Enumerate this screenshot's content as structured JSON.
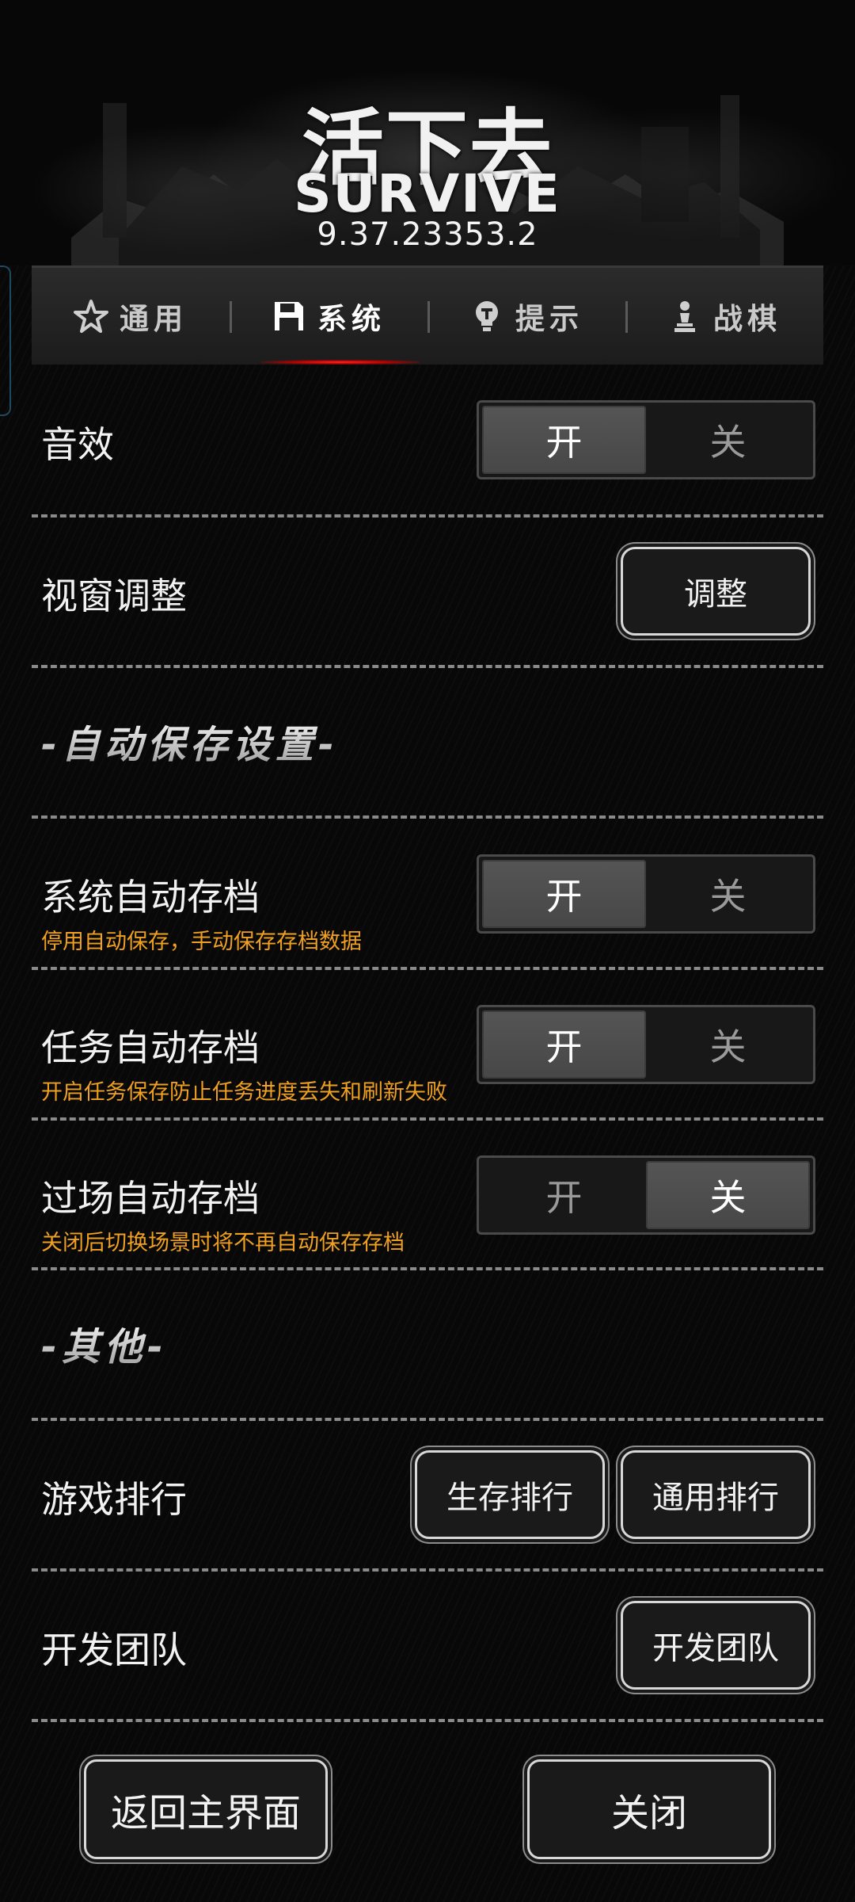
{
  "header": {
    "logo_cn": "活下去",
    "logo_en": "SURVIVE",
    "version": "9.37.23353.2"
  },
  "tabs": [
    {
      "label": "通用",
      "icon": "star-icon",
      "active": false
    },
    {
      "label": "系统",
      "icon": "floppy-disk-icon",
      "active": true
    },
    {
      "label": "提示",
      "icon": "lightbulb-icon",
      "active": false
    },
    {
      "label": "战棋",
      "icon": "chess-pawn-icon",
      "active": false
    }
  ],
  "settings": {
    "sound": {
      "label": "音效",
      "on": "开",
      "off": "关",
      "value": "on"
    },
    "viewport": {
      "label": "视窗调整",
      "button": "调整"
    },
    "autosave_section": "-自动保存设置-",
    "system_autosave": {
      "label": "系统自动存档",
      "hint": "停用自动保存，手动保存存档数据",
      "on": "开",
      "off": "关",
      "value": "on"
    },
    "task_autosave": {
      "label": "任务自动存档",
      "hint": "开启任务保存防止任务进度丢失和刷新失败",
      "on": "开",
      "off": "关",
      "value": "on"
    },
    "cutscene_autosave": {
      "label": "过场自动存档",
      "hint": "关闭后切换场景时将不再自动保存存档",
      "on": "开",
      "off": "关",
      "value": "off"
    },
    "other_section": "-其他-",
    "ranking": {
      "label": "游戏排行",
      "survival_button": "生存排行",
      "general_button": "通用排行"
    },
    "dev_team": {
      "label": "开发团队",
      "button": "开发团队"
    }
  },
  "footer": {
    "back_button": "返回主界面",
    "close_button": "关闭"
  },
  "colors": {
    "background": "#080808",
    "hint": "#f0a020",
    "active_tab_underline": "#ff2a2a",
    "toggle_selected": "#505050"
  }
}
